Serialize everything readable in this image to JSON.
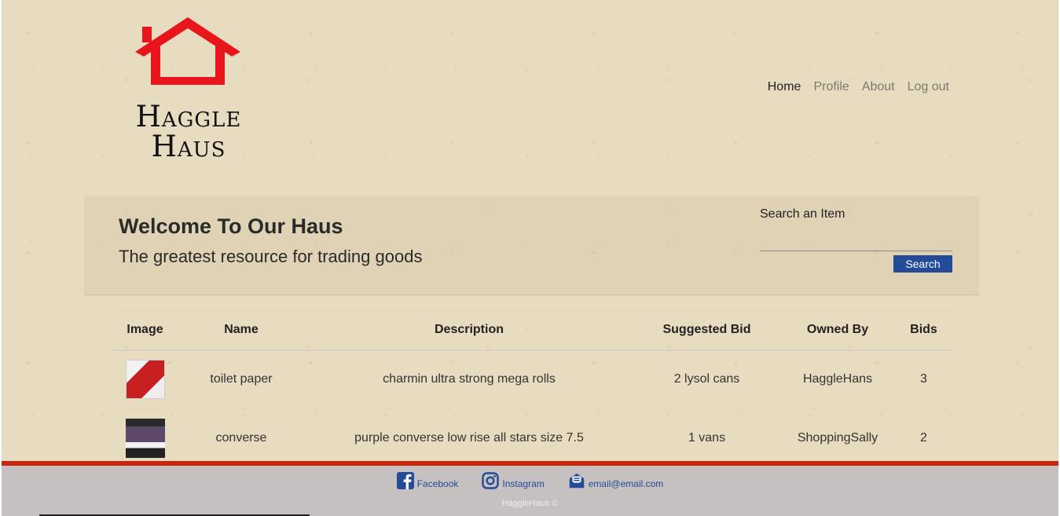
{
  "brand": {
    "name": "Haggle Haus",
    "logo_color": "#e8161b"
  },
  "nav": {
    "items": [
      "Home",
      "Profile",
      "About",
      "Log out"
    ]
  },
  "hero": {
    "title": "Welcome To Our Haus",
    "subtitle": "The greatest resource for trading goods",
    "search_label": "Search an Item",
    "search_value": "",
    "search_button": "Search"
  },
  "table": {
    "headers": [
      "Image",
      "Name",
      "Description",
      "Suggested Bid",
      "Owned By",
      "Bids"
    ],
    "rows": [
      {
        "image": "toilet-paper-thumbnail",
        "name": "toilet paper",
        "description": "charmin ultra strong mega rolls",
        "suggested_bid": "2 lysol cans",
        "owner": "HaggleHans",
        "bids": "3"
      },
      {
        "image": "converse-thumbnail",
        "name": "converse",
        "description": "purple converse low rise all stars size 7.5",
        "suggested_bid": "1 vans",
        "owner": "ShoppingSally",
        "bids": "2"
      }
    ]
  },
  "footer": {
    "facebook": "Facebook",
    "instagram": "Instagram",
    "email": "email@email.com",
    "copyright": "HaggleHaus ©",
    "accent": "#c8260d",
    "link_color": "#234b97"
  }
}
